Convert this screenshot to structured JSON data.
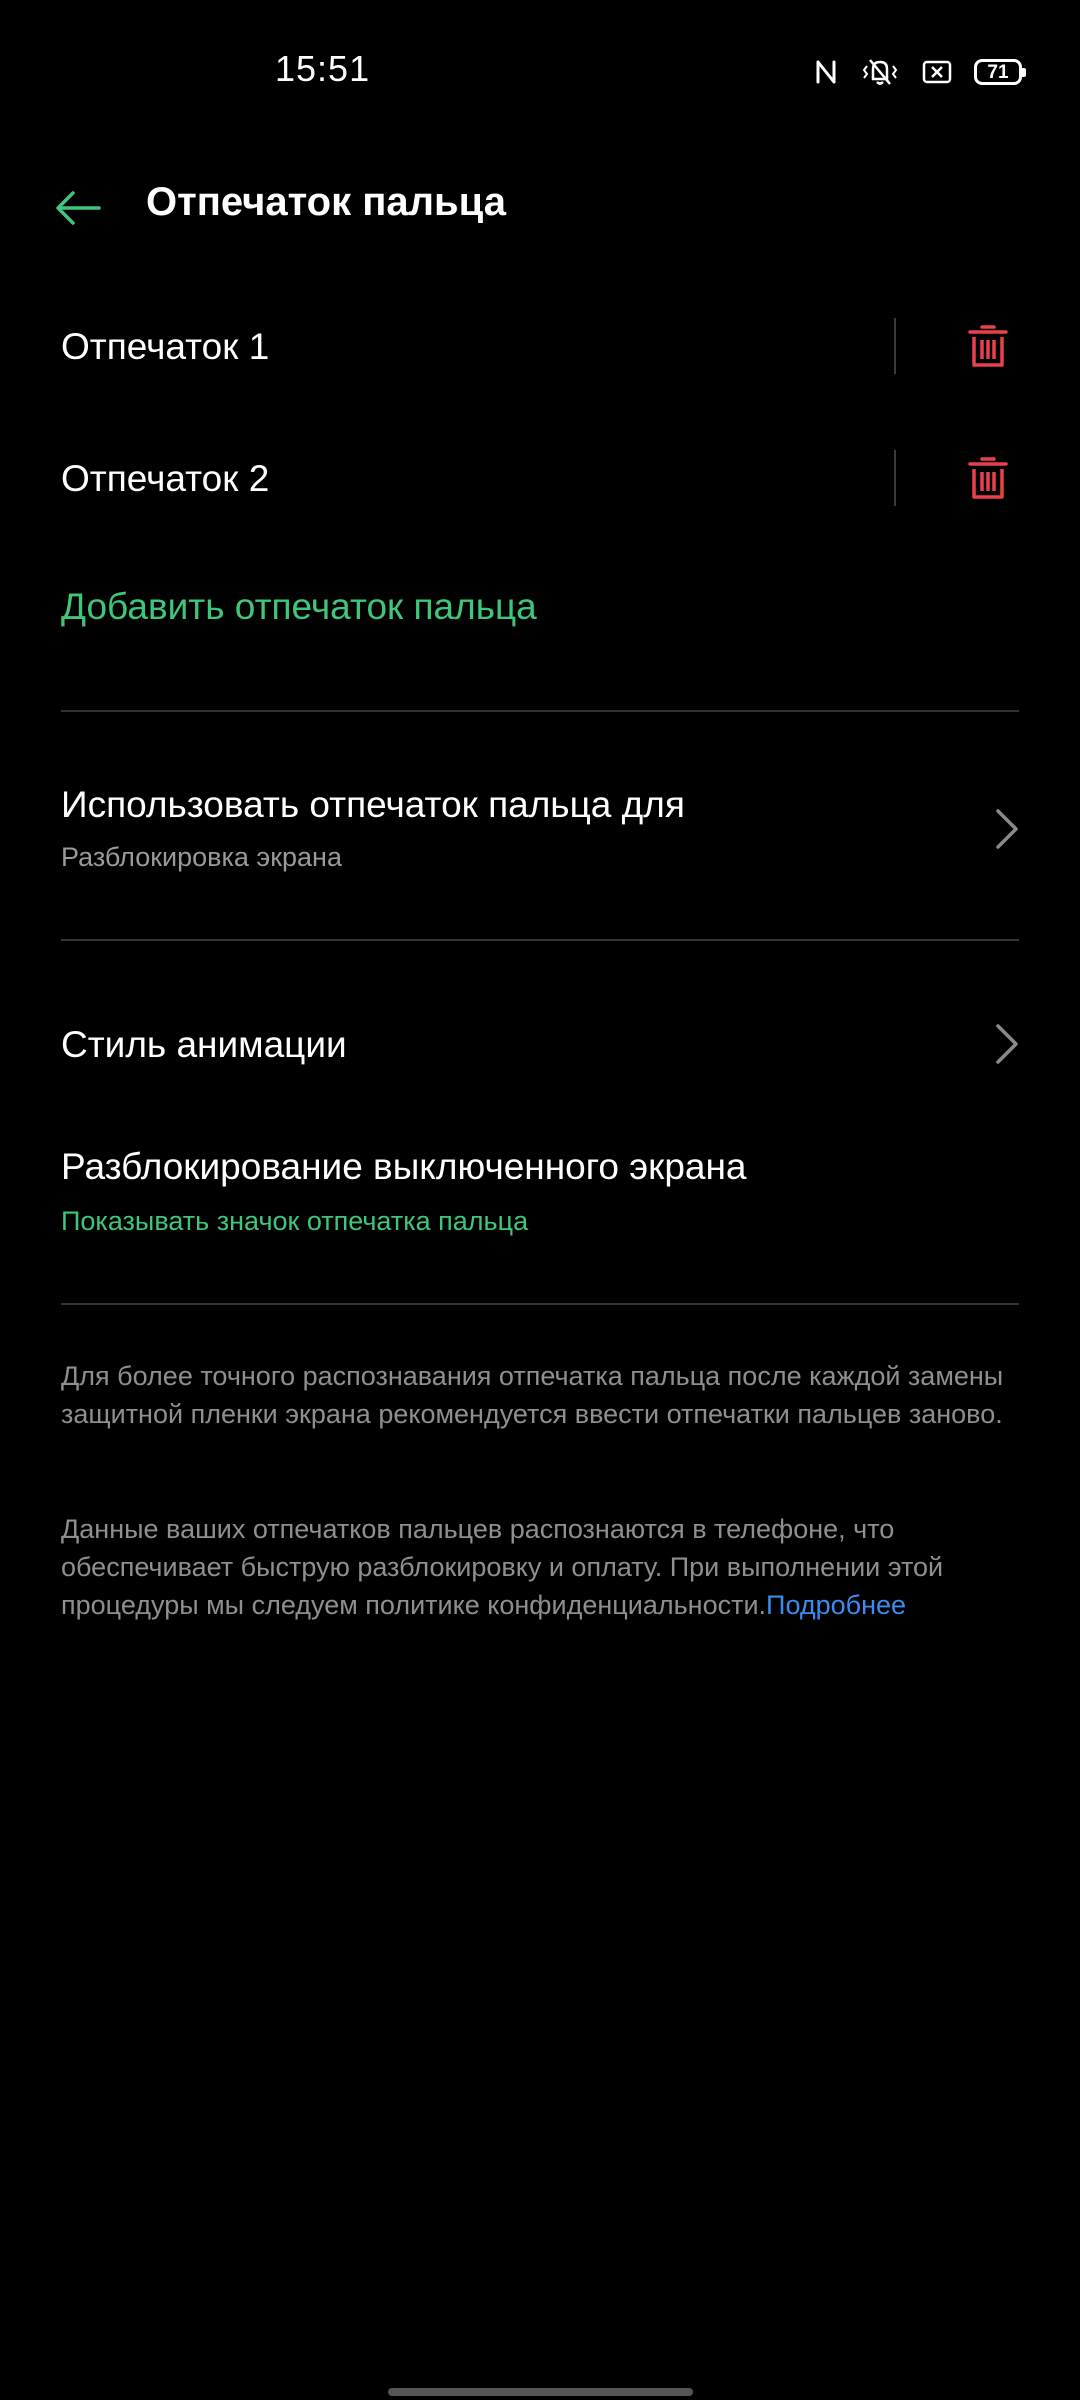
{
  "status_bar": {
    "time": "15:51",
    "icons": [
      "nfc-icon",
      "vibrate-icon",
      "screen-record-icon",
      "battery-icon"
    ],
    "battery_level": "71"
  },
  "header": {
    "title": "Отпечаток пальца",
    "back_icon": "back-arrow-icon"
  },
  "fingerprints": [
    {
      "label": "Отпечаток 1",
      "action_icon": "trash-icon"
    },
    {
      "label": "Отпечаток 2",
      "action_icon": "trash-icon"
    }
  ],
  "add_fingerprint_label": "Добавить отпечаток пальца",
  "menu": {
    "use_for": {
      "title": "Использовать отпечаток пальца для",
      "subtitle": "Разблокировка экрана"
    },
    "animation_style": {
      "title": "Стиль анимации"
    },
    "screen_off_unlock": {
      "title": "Разблокирование выключенного экрана",
      "subtitle": "Показывать значок отпечатка пальца"
    }
  },
  "info": {
    "paragraph1": "Для более точного распознавания отпечатка пальца после каждой замены защитной пленки экрана рекомендуется ввести отпечатки пальцев заново.",
    "paragraph2": "Данные ваших отпечатков пальцев распознаются в телефоне, что обеспечивает быструю разблокировку и оплату. При выполнении этой процедуры мы следуем политике конфиденциальности.",
    "link": "Подробнее"
  },
  "colors": {
    "background": "#000000",
    "accent_green": "#3ec77b",
    "delete_red": "#e8414b",
    "link_blue": "#3d8bf0",
    "secondary_text": "#9a9a9a"
  }
}
